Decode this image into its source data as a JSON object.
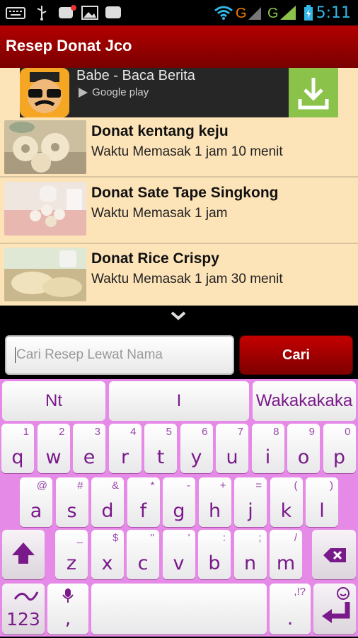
{
  "status_bar": {
    "time": "5:11",
    "icons": [
      "keyboard-icon",
      "usb-icon",
      "bbm-notification-icon",
      "gallery-icon",
      "bbm-icon",
      "wifi-icon",
      "signal-g-icon",
      "signal-g-icon",
      "battery-charging-icon"
    ]
  },
  "app_bar": {
    "title": "Resep Donat Jco"
  },
  "ad": {
    "title": "Babe - Baca Berita",
    "store": "Google play"
  },
  "recipes": [
    {
      "title": "Donat kentang keju",
      "time": "Waktu Memasak 1 jam 10 menit"
    },
    {
      "title": "Donat Sate Tape Singkong",
      "time": "Waktu Memasak 1 jam"
    },
    {
      "title": "Donat Rice Crispy",
      "time": "Waktu Memasak 1 jam 30 menit"
    }
  ],
  "search": {
    "placeholder": "Cari Resep Lewat Nama",
    "value": "",
    "button_label": "Cari"
  },
  "keyboard": {
    "suggestions": [
      "Nt",
      "I",
      "Wakakakaka"
    ],
    "row1": [
      {
        "k": "q",
        "h": "1"
      },
      {
        "k": "w",
        "h": "2"
      },
      {
        "k": "e",
        "h": "3"
      },
      {
        "k": "r",
        "h": "4"
      },
      {
        "k": "t",
        "h": "5"
      },
      {
        "k": "y",
        "h": "6"
      },
      {
        "k": "u",
        "h": "7"
      },
      {
        "k": "i",
        "h": "8"
      },
      {
        "k": "o",
        "h": "9"
      },
      {
        "k": "p",
        "h": "0"
      }
    ],
    "row2": [
      {
        "k": "a",
        "h": "@"
      },
      {
        "k": "s",
        "h": "#"
      },
      {
        "k": "d",
        "h": "&"
      },
      {
        "k": "f",
        "h": "*"
      },
      {
        "k": "g",
        "h": "-"
      },
      {
        "k": "h",
        "h": "+"
      },
      {
        "k": "j",
        "h": "="
      },
      {
        "k": "k",
        "h": "("
      },
      {
        "k": "l",
        "h": ")"
      }
    ],
    "row3": [
      {
        "k": "z",
        "h": "_"
      },
      {
        "k": "x",
        "h": "$"
      },
      {
        "k": "c",
        "h": "\""
      },
      {
        "k": "v",
        "h": "'"
      },
      {
        "k": "b",
        "h": ":"
      },
      {
        "k": "n",
        "h": ";"
      },
      {
        "k": "m",
        "h": "/"
      }
    ],
    "numbers_label": "123",
    "comma_label": ",",
    "period_label": ".",
    "period_hint": ",!?"
  },
  "colors": {
    "app_bar": "#a00000",
    "content_bg": "#fde3b8",
    "keyboard_bg": "#e58ae6",
    "key_text": "#7a1a8a",
    "time": "#33b5e5",
    "ad_download": "#8bc34a"
  }
}
